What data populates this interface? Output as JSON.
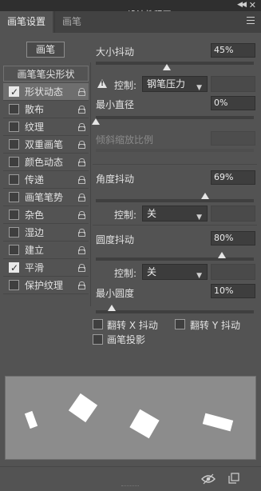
{
  "window": {
    "collapse_glyph": "◀◀",
    "close_glyph": "✕",
    "watermark": "PS设计教程网 www.MISSYUAN.NET"
  },
  "tabs": [
    {
      "label": "画笔设置",
      "active": true
    },
    {
      "label": "画笔",
      "active": false
    }
  ],
  "brush_button_label": "画笔",
  "brush_tip_label": "画笔笔尖形状",
  "options": [
    {
      "label": "形状动态",
      "checked": true,
      "selected": true
    },
    {
      "label": "散布",
      "checked": false
    },
    {
      "label": "纹理",
      "checked": false
    },
    {
      "label": "双重画笔",
      "checked": false
    },
    {
      "label": "颜色动态",
      "checked": false
    },
    {
      "label": "传递",
      "checked": false
    },
    {
      "label": "画笔笔势",
      "checked": false
    },
    {
      "label": "杂色",
      "checked": false
    },
    {
      "label": "湿边",
      "checked": false
    },
    {
      "label": "建立",
      "checked": false
    },
    {
      "label": "平滑",
      "checked": true
    },
    {
      "label": "保护纹理",
      "checked": false
    }
  ],
  "settings": {
    "size_jitter": {
      "label": "大小抖动",
      "value": "45%",
      "level": 0.45
    },
    "size_control": {
      "label": "控制:",
      "value": "钢笔压力"
    },
    "min_diameter": {
      "label": "最小直径",
      "value": "0%",
      "level": 0.0
    },
    "tilt_scale": {
      "label": "倾斜缩放比例",
      "value": ""
    },
    "angle_jitter": {
      "label": "角度抖动",
      "value": "69%",
      "level": 0.69
    },
    "angle_control": {
      "label": "控制:",
      "value": "关"
    },
    "roundness_jitter": {
      "label": "圆度抖动",
      "value": "80%",
      "level": 0.8
    },
    "roundness_control": {
      "label": "控制:",
      "value": "关"
    },
    "min_roundness": {
      "label": "最小圆度",
      "value": "10%",
      "level": 0.1
    }
  },
  "flip_x": {
    "label": "翻转 X 抖动",
    "checked": false
  },
  "flip_y": {
    "label": "翻转 Y 抖动",
    "checked": false
  },
  "brush_projection": {
    "label": "画笔投影",
    "checked": false
  },
  "icons": {
    "eye": "eye-icon",
    "new_preset": "new-preset-icon",
    "warning": "warning-icon",
    "lock": "lock-icon"
  }
}
